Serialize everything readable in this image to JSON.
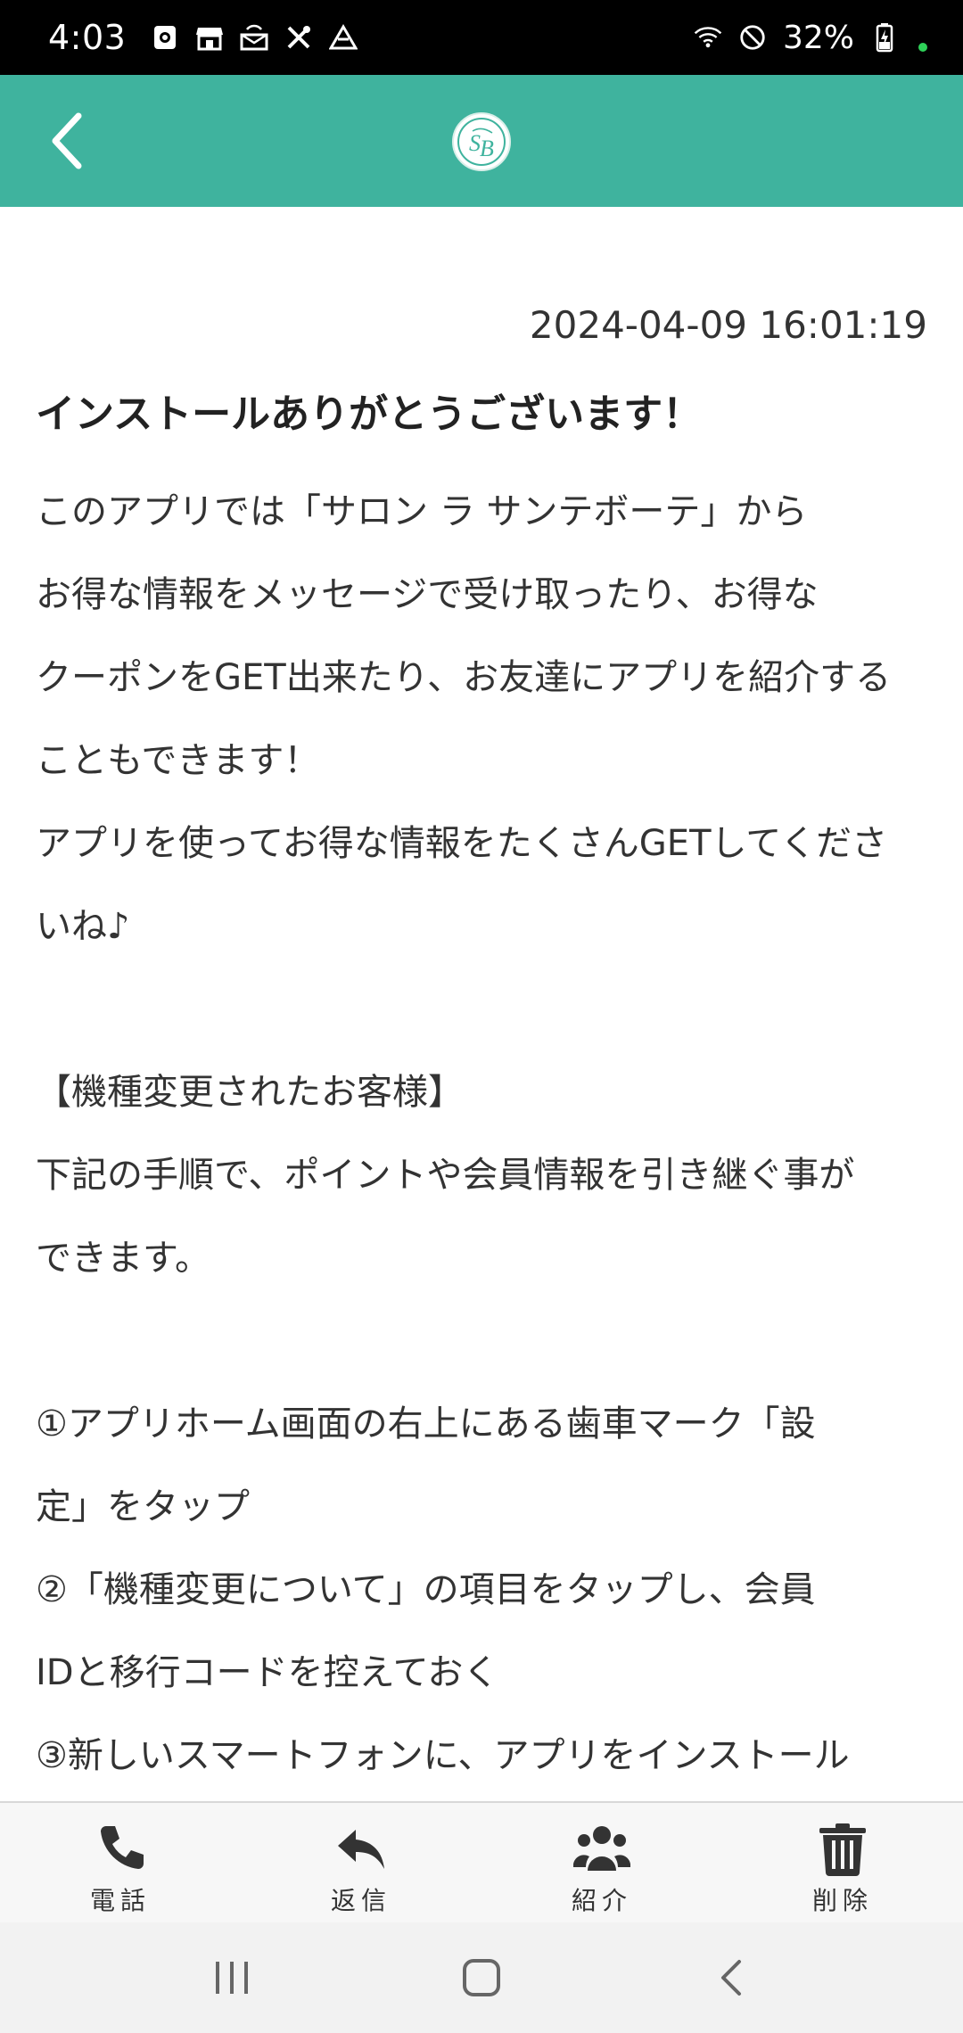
{
  "status_bar": {
    "time": "4:03",
    "battery": "32%"
  },
  "header": {
    "logo_alt": "SB"
  },
  "message": {
    "timestamp": "2024-04-09 16:01:19",
    "title": "インストールありがとうございます！",
    "lines": [
      "このアプリでは「サロン ラ サンテボーテ」から",
      "お得な情報をメッセージで受け取ったり、お得な",
      "クーポンをGET出来たり、お友達にアプリを紹介する",
      "こともできます！",
      "アプリを使ってお得な情報をたくさんGETしてくださ",
      "いね♪",
      "",
      "【機種変更されたお客様】",
      "下記の手順で、ポイントや会員情報を引き継ぐ事が",
      "できます。",
      "",
      "①アプリホーム画面の右上にある歯車マーク「設",
      "定」をタップ",
      "②「機種変更について」の項目をタップし、会員",
      "IDと移行コードを控えておく",
      "③新しいスマートフォンに、アプリをインストール"
    ]
  },
  "actions": {
    "phone": "電話",
    "reply": "返信",
    "introduce": "紹介",
    "delete": "削除"
  }
}
